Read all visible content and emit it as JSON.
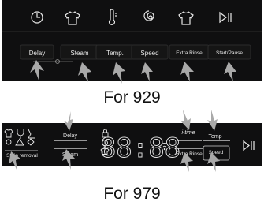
{
  "panel_929": {
    "buttons": [
      "Delay",
      "Steam",
      "Temp.",
      "Speed",
      "Extra Rinse",
      "Start/Pause"
    ],
    "icons": [
      "clock-icon",
      "shirt-icon",
      "thermometer-icon",
      "spiral-icon",
      "shirt-drops-icon",
      "play-pause-icon"
    ],
    "caption": "For 929"
  },
  "panel_979": {
    "stain_label": "Stain removal",
    "left_buttons": [
      "Delay",
      "Steam"
    ],
    "display_digits": "88:88",
    "right_buttons": [
      "Temp",
      "Speed",
      "Extra Rinse"
    ],
    "i_time_label": "i-time",
    "caption": "For 979"
  },
  "colors": {
    "panel": "#0f0f10",
    "arrow": "#aaaaaa",
    "text": "#e8e8e8"
  }
}
